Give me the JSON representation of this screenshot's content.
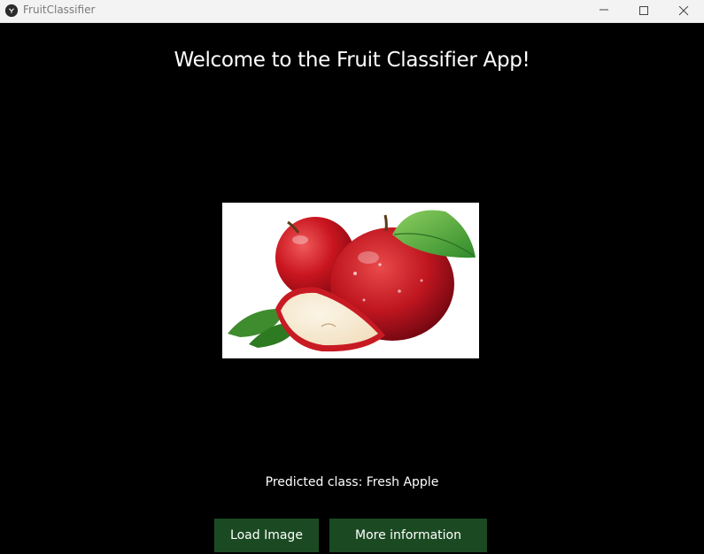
{
  "window": {
    "title": "FruitClassifier",
    "app_icon": "kivy-logo-icon",
    "controls": [
      "minimize-icon",
      "maximize-icon",
      "close-icon"
    ]
  },
  "main": {
    "heading": "Welcome to the Fruit Classifier App!",
    "image": {
      "description_icon": "apple-photo",
      "alt": "Fruit image"
    },
    "prediction": "Predicted class: Fresh Apple"
  },
  "buttons": {
    "load_image": "Load Image",
    "more_info": "More information"
  },
  "colors": {
    "background": "#000000",
    "titlebar": "#f3f3f3",
    "button": "#1b4a22",
    "text": "#ffffff"
  }
}
